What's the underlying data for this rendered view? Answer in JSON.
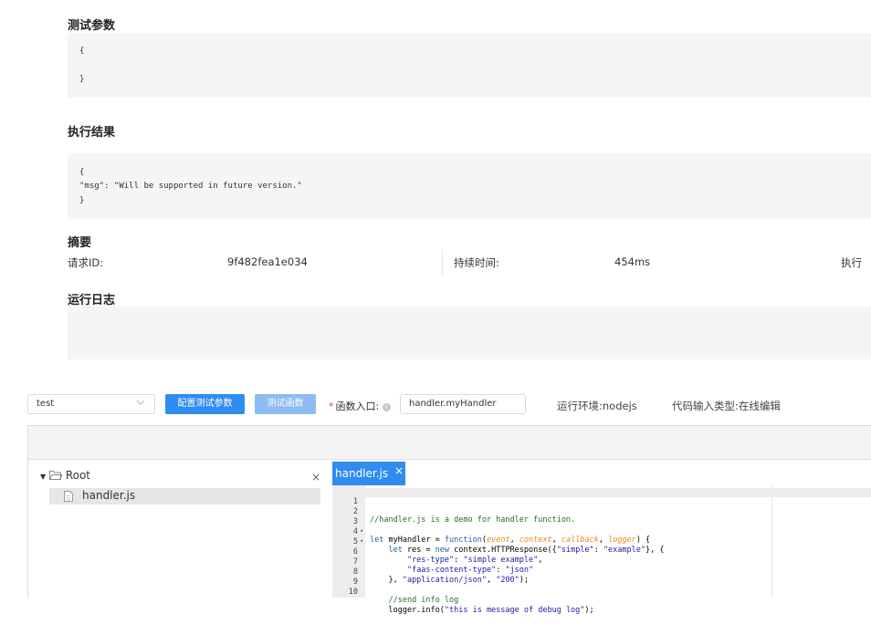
{
  "sections": {
    "test_params": {
      "title": "测试参数",
      "lines": [
        "{",
        "}"
      ]
    },
    "exec_result": {
      "title": "执行结果",
      "lines": [
        "{",
        "\"msg\": \"Will be supported in future version.\"",
        "}"
      ]
    },
    "summary": {
      "title": "摘要",
      "request_id_label": "请求ID:",
      "request_id_value": "9f482fea1e034",
      "duration_label": "持续时间:",
      "duration_value": "454ms",
      "exec_label_truncated": "执行"
    },
    "run_log": {
      "title": "运行日志"
    }
  },
  "toolbar": {
    "select_value": "test",
    "config_params_button": "配置测试参数",
    "test_function_button": "测试函数",
    "entry_label": "函数入口:",
    "entry_required_mark": "*",
    "entry_value": "handler.myHandler",
    "runtime_text": "运行环境:nodejs",
    "code_input_type_text": "代码输入类型:在线编辑"
  },
  "file_tree": {
    "root_label": "Root",
    "close_symbol": "×",
    "files": [
      "handler.js"
    ]
  },
  "editor": {
    "active_tab": "handler.js",
    "tab_close_symbol": "×",
    "line_numbers": [
      "1",
      "2",
      "3",
      "4",
      "5",
      "6",
      "7",
      "8",
      "9",
      "10"
    ],
    "fold_markers": [
      "",
      "",
      "▾",
      "▾",
      "",
      "",
      "",
      "",
      "",
      ""
    ]
  },
  "colors": {
    "primary": "#2f8cf0",
    "primary_disabled": "#8cbcf2",
    "panel_bg": "#f5f5f5",
    "required": "#e74c3c"
  }
}
